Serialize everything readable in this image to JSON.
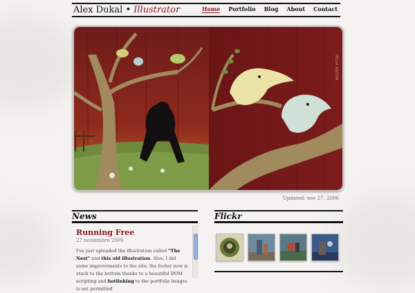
{
  "brand": {
    "name": "Alex Dukal",
    "separator": "•",
    "role": "Illustrator"
  },
  "nav": {
    "home": "Home",
    "portfolio": "Portfolio",
    "blog": "Blog",
    "about": "About",
    "contact": "Contact"
  },
  "hero": {
    "spine_text": "PELLA VISITOR"
  },
  "updated": "Updated: nov 27, 2006",
  "news": {
    "heading": "News",
    "post_title": "Running Free",
    "post_date": "27 noviembre 2006",
    "p1": "I've just uploaded the illustration called ",
    "p1_link": "\"The Nest\"",
    "p2": " and ",
    "p2_link": "this old illustration",
    "p3": ". Also, I did some improvements to the site: the footer now is stuck to the bottom thanks to a beautiful DOM scripting and ",
    "p3_link": "hotlinking",
    "p4": " to the portfolio images is not permitted"
  },
  "flickr": {
    "heading": "Flickr"
  },
  "colors": {
    "accent": "#8a1a22",
    "rule": "#111111",
    "scroll_thumb": "#9bb0d8"
  }
}
